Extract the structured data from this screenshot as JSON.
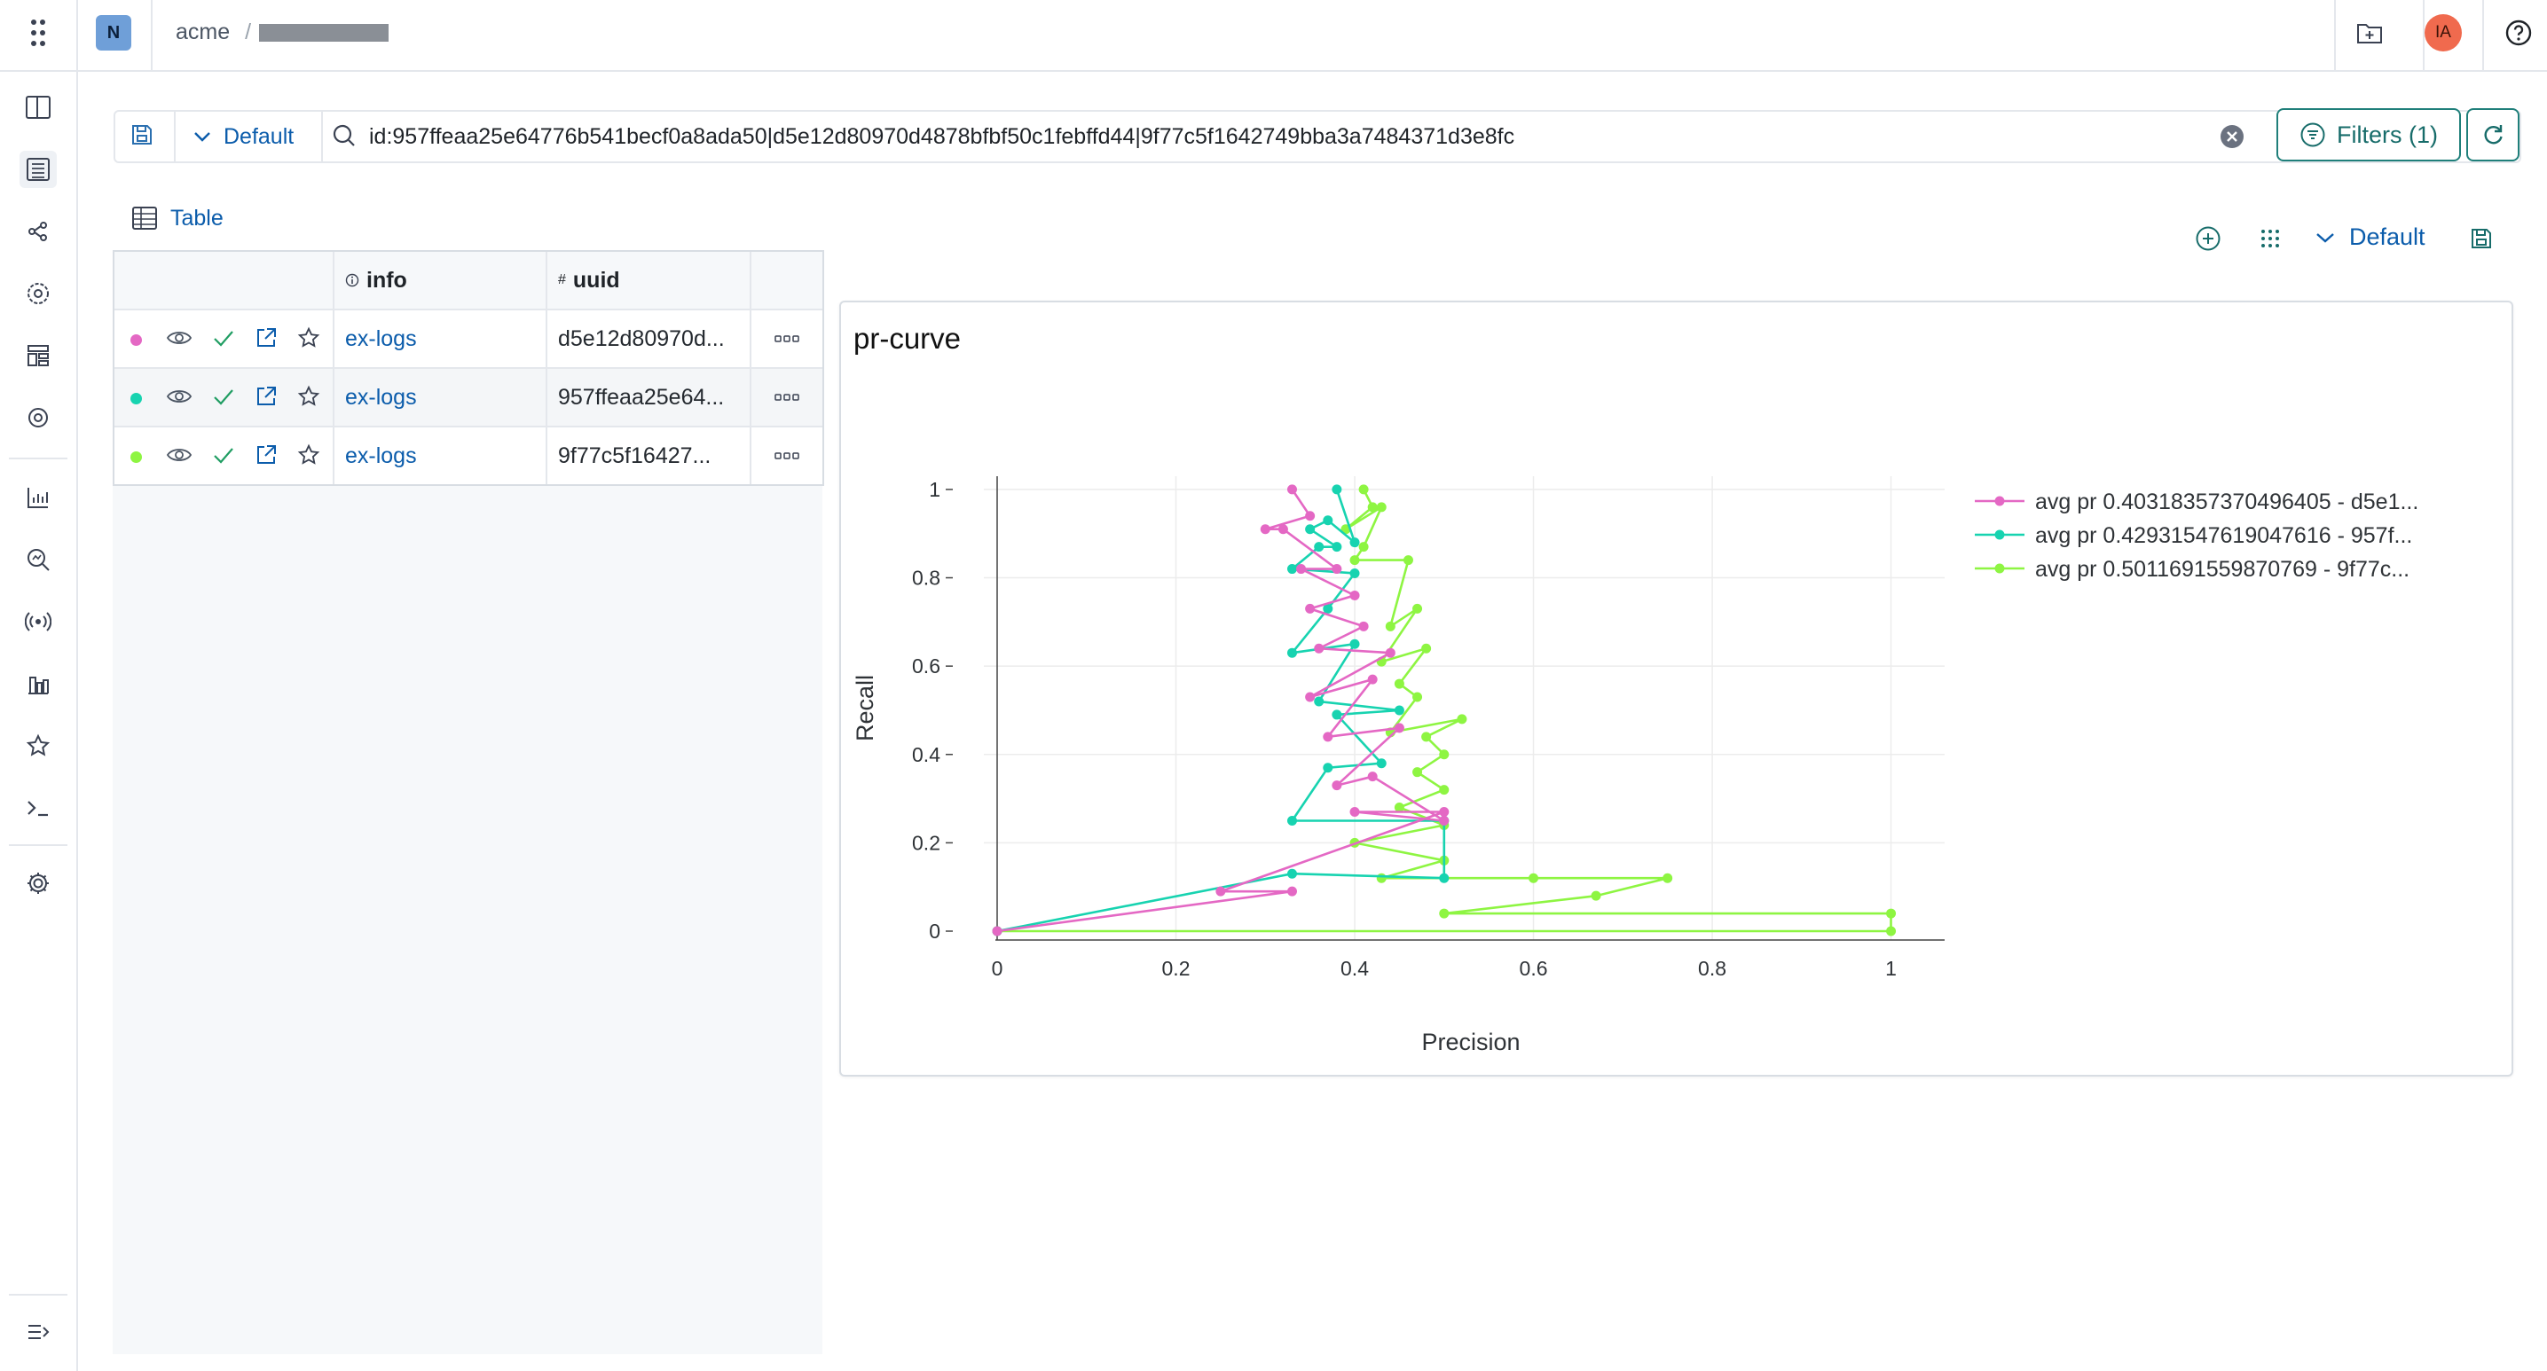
{
  "header": {
    "workspace_badge": "N",
    "org": "acme",
    "separator": "/",
    "avatar_initials": "IA"
  },
  "search": {
    "view_name": "Default",
    "query": "id:957ffeaa25e64776b541becf0a8ada50|d5e12d80970d4878bfbf50c1febffd44|9f77c5f1642749bba3a7484371d3e8fc",
    "filters_label": "Filters (1)"
  },
  "table": {
    "tab_label": "Table",
    "columns": [
      "info",
      "uuid"
    ],
    "rows": [
      {
        "name": "ex-logs",
        "uuid": "d5e12d80970d...",
        "color": "#e468c4"
      },
      {
        "name": "ex-logs",
        "uuid": "957ffeaa25e64...",
        "color": "#17d3b0"
      },
      {
        "name": "ex-logs",
        "uuid": "9f77c5f16427...",
        "color": "#8ef542"
      }
    ]
  },
  "chart_toolbar": {
    "view_name": "Default"
  },
  "chart_data": {
    "type": "line",
    "title": "pr-curve",
    "xlabel": "Precision",
    "ylabel": "Recall",
    "xlim": [
      0,
      1.06
    ],
    "ylim": [
      0,
      1.05
    ],
    "xticks": [
      "0",
      "0.2",
      "0.4",
      "0.6",
      "0.8",
      "1"
    ],
    "yticks": [
      "0",
      "0.2",
      "0.4",
      "0.6",
      "0.8",
      "1"
    ],
    "grid": true,
    "legend_position": "right",
    "series": [
      {
        "name": "avg pr 0.40318357370496405 - d5e1...",
        "color": "#e468c4",
        "x": [
          0,
          0.33,
          0.25,
          0.5,
          0.4,
          0.5,
          0.42,
          0.38,
          0.45,
          0.37,
          0.42,
          0.35,
          0.44,
          0.36,
          0.41,
          0.35,
          0.4,
          0.34,
          0.38,
          0.32,
          0.3,
          0.35,
          0.33
        ],
        "y": [
          0,
          0.09,
          0.09,
          0.27,
          0.27,
          0.25,
          0.35,
          0.33,
          0.46,
          0.44,
          0.57,
          0.53,
          0.63,
          0.64,
          0.69,
          0.73,
          0.76,
          0.82,
          0.82,
          0.91,
          0.91,
          0.94,
          1.0
        ]
      },
      {
        "name": "avg pr 0.42931547619047616 - 957f...",
        "color": "#17d3b0",
        "x": [
          0,
          0.33,
          0.5,
          0.5,
          0.33,
          0.37,
          0.43,
          0.38,
          0.45,
          0.36,
          0.4,
          0.33,
          0.37,
          0.4,
          0.33,
          0.36,
          0.38,
          0.35,
          0.37,
          0.4,
          0.38
        ],
        "y": [
          0,
          0.13,
          0.12,
          0.25,
          0.25,
          0.37,
          0.38,
          0.49,
          0.5,
          0.52,
          0.65,
          0.63,
          0.73,
          0.81,
          0.82,
          0.87,
          0.87,
          0.91,
          0.93,
          0.88,
          1.0
        ]
      },
      {
        "name": "avg pr 0.5011691559870769 - 9f77c...",
        "color": "#8ef542",
        "x": [
          0,
          1,
          1,
          0.5,
          0.67,
          0.75,
          0.6,
          0.43,
          0.5,
          0.4,
          0.5,
          0.45,
          0.5,
          0.47,
          0.5,
          0.48,
          0.52,
          0.44,
          0.47,
          0.45,
          0.48,
          0.43,
          0.47,
          0.44,
          0.46,
          0.4,
          0.41,
          0.43,
          0.39,
          0.42,
          0.41
        ],
        "y": [
          0,
          0.0,
          0.04,
          0.04,
          0.08,
          0.12,
          0.12,
          0.12,
          0.16,
          0.2,
          0.24,
          0.28,
          0.32,
          0.36,
          0.4,
          0.44,
          0.48,
          0.45,
          0.53,
          0.56,
          0.64,
          0.61,
          0.73,
          0.69,
          0.84,
          0.84,
          0.87,
          0.96,
          0.91,
          0.96,
          1.0
        ]
      }
    ]
  }
}
